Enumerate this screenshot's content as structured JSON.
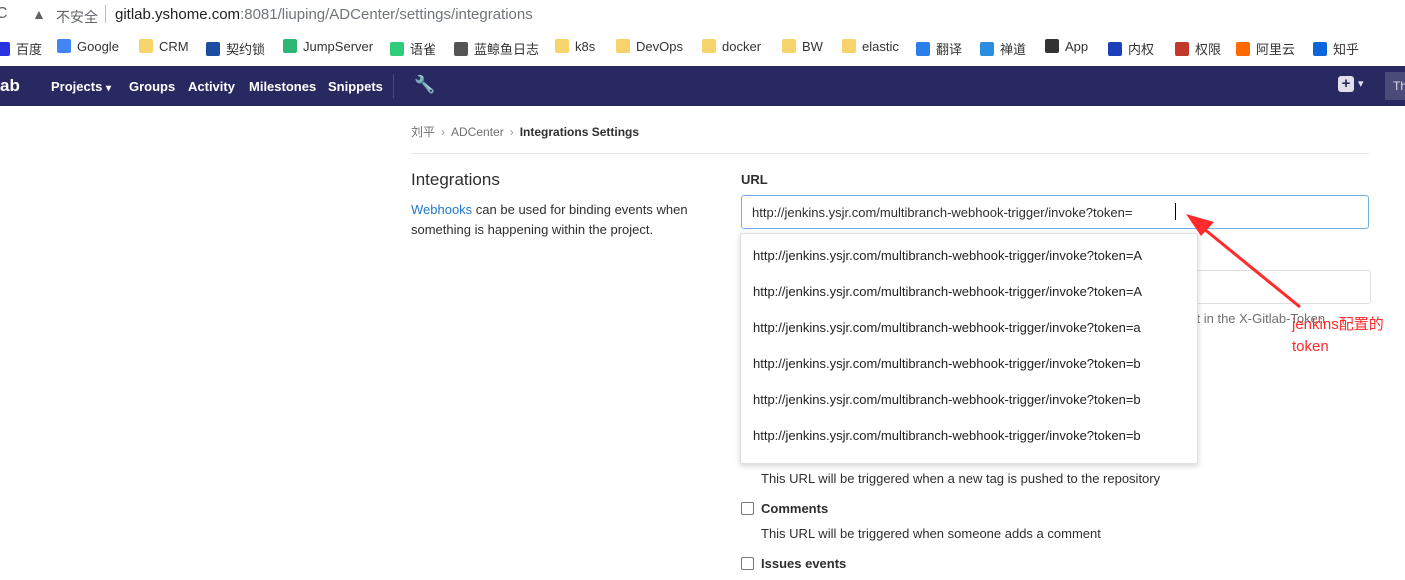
{
  "browser": {
    "security_label": "不安全",
    "url_host": "gitlab.yshome.com",
    "url_rest": ":8081/liuping/ADCenter/settings/integrations"
  },
  "bookmarks": [
    {
      "label": "百度",
      "icon": "baidu-icon",
      "color": "#2932e1"
    },
    {
      "label": "Google",
      "icon": "google-icon",
      "color": "#4285f4"
    },
    {
      "label": "CRM",
      "icon": "folder-icon",
      "color": "#f6d36b"
    },
    {
      "label": "契约锁",
      "icon": "qiyuesuo-icon",
      "color": "#1b4ea0"
    },
    {
      "label": "JumpServer",
      "icon": "jumpserver-icon",
      "color": "#2bb673"
    },
    {
      "label": "语雀",
      "icon": "yuque-icon",
      "color": "#31cc79"
    },
    {
      "label": "蓝鲸鱼日志",
      "icon": "bluewhale-icon",
      "color": "#555555"
    },
    {
      "label": "k8s",
      "icon": "folder-icon",
      "color": "#f6d36b"
    },
    {
      "label": "DevOps",
      "icon": "folder-icon",
      "color": "#f6d36b"
    },
    {
      "label": "docker",
      "icon": "folder-icon",
      "color": "#f6d36b"
    },
    {
      "label": "BW",
      "icon": "folder-icon",
      "color": "#f6d36b"
    },
    {
      "label": "elastic",
      "icon": "folder-icon",
      "color": "#f6d36b"
    },
    {
      "label": "翻译",
      "icon": "translate-icon",
      "color": "#2b7de9"
    },
    {
      "label": "禅道",
      "icon": "zentao-icon",
      "color": "#2b8de0"
    },
    {
      "label": "App",
      "icon": "apple-icon",
      "color": "#333333"
    },
    {
      "label": "内权",
      "icon": "neiquan-icon",
      "color": "#1a3fb8"
    },
    {
      "label": "权限",
      "icon": "quanxian-icon",
      "color": "#c0392b"
    },
    {
      "label": "阿里云",
      "icon": "aliyun-icon",
      "color": "#ff6a00"
    },
    {
      "label": "知乎",
      "icon": "zhihu-icon",
      "color": "#0a66d8"
    }
  ],
  "navbar": {
    "brand": "ab",
    "projects": "Projects",
    "groups": "Groups",
    "activity": "Activity",
    "milestones": "Milestones",
    "snippets": "Snippets",
    "avatar_text": "Th"
  },
  "breadcrumb": {
    "owner": "刘平",
    "project": "ADCenter",
    "current": "Integrations Settings"
  },
  "section": {
    "title": "Integrations",
    "desc_link": "Webhooks",
    "desc_rest": " can be used for binding events when something is happening within the project."
  },
  "form": {
    "url_label": "URL",
    "url_value": "http://jenkins.ysjr.com/multibranch-webhook-trigger/invoke?token=",
    "token_hint": "st in the X-Gitlab-Token"
  },
  "autocomplete": [
    "http://jenkins.ysjr.com/multibranch-webhook-trigger/invoke?token=A",
    "http://jenkins.ysjr.com/multibranch-webhook-trigger/invoke?token=A",
    "http://jenkins.ysjr.com/multibranch-webhook-trigger/invoke?token=a",
    "http://jenkins.ysjr.com/multibranch-webhook-trigger/invoke?token=b",
    "http://jenkins.ysjr.com/multibranch-webhook-trigger/invoke?token=b",
    "http://jenkins.ysjr.com/multibranch-webhook-trigger/invoke?token=b"
  ],
  "triggers": {
    "tag_help": "This URL will be triggered when a new tag is pushed to the repository",
    "comments_label": "Comments",
    "comments_help": "This URL will be triggered when someone adds a comment",
    "issues_label": "Issues events"
  },
  "annotation": {
    "line1": "jenkins配置的",
    "line2": "token",
    "color": "#ff2a2a"
  }
}
